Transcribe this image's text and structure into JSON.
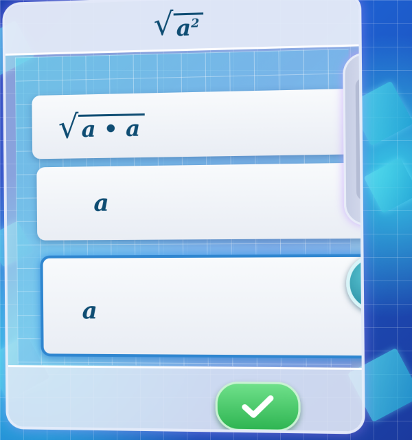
{
  "header": {
    "formula_base": "a",
    "formula_exponent": "2"
  },
  "options": [
    {
      "radicand": "a • a"
    },
    {
      "text": "a"
    },
    {
      "text": "a"
    }
  ],
  "colors": {
    "formula_text": "#0f4d73",
    "selected_border": "#2f86d0",
    "confirm_button": "#3cc45e",
    "move_up_button": "#2a90a4",
    "scroll_arrows": "#1f5aa8"
  },
  "icons": {
    "scroll_up": "scroll-up-arrow-icon",
    "scroll_down": "scroll-down-arrow-icon",
    "move_up": "up-arrow-icon",
    "confirm": "checkmark-icon"
  }
}
